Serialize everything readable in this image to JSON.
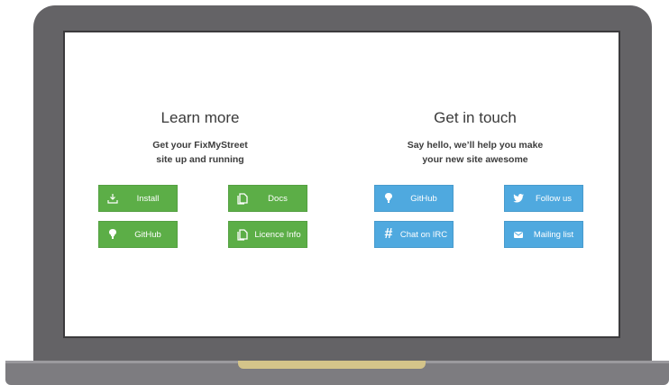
{
  "left_section": {
    "title": "Learn more",
    "subtitle_line1": "Get your FixMyStreet",
    "subtitle_line2": "site up and running",
    "buttons": [
      {
        "label": "Install",
        "icon": "download-icon"
      },
      {
        "label": "Docs",
        "icon": "document-icon"
      },
      {
        "label": "GitHub",
        "icon": "github-icon"
      },
      {
        "label": "Licence Info",
        "icon": "document-icon"
      }
    ]
  },
  "right_section": {
    "title": "Get in touch",
    "subtitle_line1": "Say hello, we’ll help you make",
    "subtitle_line2": "your new site awesome",
    "buttons": [
      {
        "label": "GitHub",
        "icon": "github-icon"
      },
      {
        "label": "Follow us",
        "icon": "twitter-icon"
      },
      {
        "label": "Chat on IRC",
        "icon": "hash-icon"
      },
      {
        "label": "Mailing list",
        "icon": "mail-icon"
      }
    ]
  },
  "colors": {
    "green_button": "#5cae47",
    "blue_button": "#4fa9df",
    "laptop_frame": "#646366",
    "hinge": "#d4c48a"
  }
}
